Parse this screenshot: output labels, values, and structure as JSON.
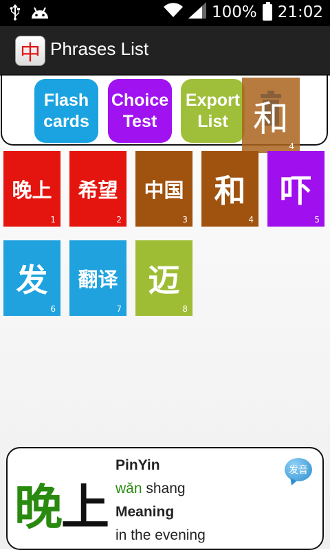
{
  "status_bar": {
    "battery": "100%",
    "time": "21:02",
    "icons": [
      "usb-icon",
      "android-icon",
      "wifi-icon",
      "signal-icon",
      "battery-icon"
    ]
  },
  "app": {
    "title": "Phrases List",
    "icon_char": "中"
  },
  "toolbar": {
    "flash": {
      "line1": "Flash",
      "line2": "cards",
      "color": "#1aa3e0"
    },
    "choice": {
      "line1": "Choice",
      "line2": "Test",
      "color": "#a012f0"
    },
    "export": {
      "line1": "Export",
      "line2": "List",
      "color": "#9fbf3a"
    }
  },
  "drag_tile": {
    "text": "和",
    "num": "4",
    "color": "#a55f1e"
  },
  "tiles": [
    {
      "text": "晚上",
      "num": "1",
      "color": "#e3150e"
    },
    {
      "text": "希望",
      "num": "2",
      "color": "#e3150e"
    },
    {
      "text": "中国",
      "num": "3",
      "color": "#a0520f"
    },
    {
      "text": "和",
      "num": "4",
      "color": "#a0520f"
    },
    {
      "text": "吓",
      "num": "5",
      "color": "#a010ee"
    },
    {
      "text": "发",
      "num": "6",
      "color": "#1fa2de"
    },
    {
      "text": "翻译",
      "num": "7",
      "color": "#1fa2de"
    },
    {
      "text": "迈",
      "num": "8",
      "color": "#9ebd35"
    }
  ],
  "detail": {
    "char1": "晚",
    "char2": "上",
    "char1_color": "#2a8a10",
    "char2_color": "#111111",
    "pinyin_label": "PinYin",
    "pinyin_1": "wǎn",
    "pinyin_2": " shang",
    "meaning_label": "Meaning",
    "meaning": "in the evening",
    "speaker_label": "发音"
  }
}
